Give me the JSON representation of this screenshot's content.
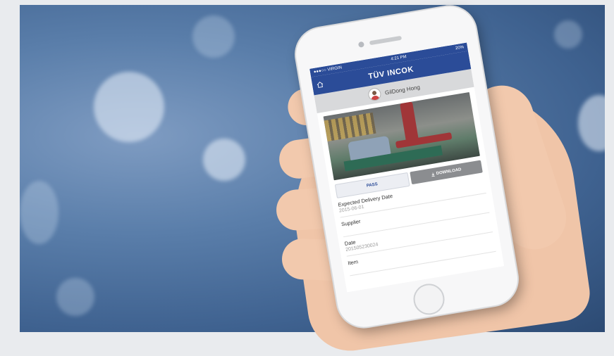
{
  "status_bar": {
    "carrier": "●●●○○ VIRGIN",
    "time": "4:21 PM",
    "battery": "20%"
  },
  "nav": {
    "title": "TÜV INCOK",
    "home_icon": "home-icon"
  },
  "user": {
    "name": "GilDong Hong",
    "avatar_icon": "avatar"
  },
  "actions": {
    "pass_label": "PASS",
    "download_label": "DOWNLOAD",
    "download_icon": "download-icon"
  },
  "fields": [
    {
      "label": "Expected Delivery Date",
      "value": "2015-06-01"
    },
    {
      "label": "Supplier",
      "value": ""
    },
    {
      "label": "Date",
      "value": "201505230024"
    },
    {
      "label": "Item",
      "value": ""
    }
  ],
  "colors": {
    "brand": "#2b4c98",
    "background": "#4f74a3"
  }
}
